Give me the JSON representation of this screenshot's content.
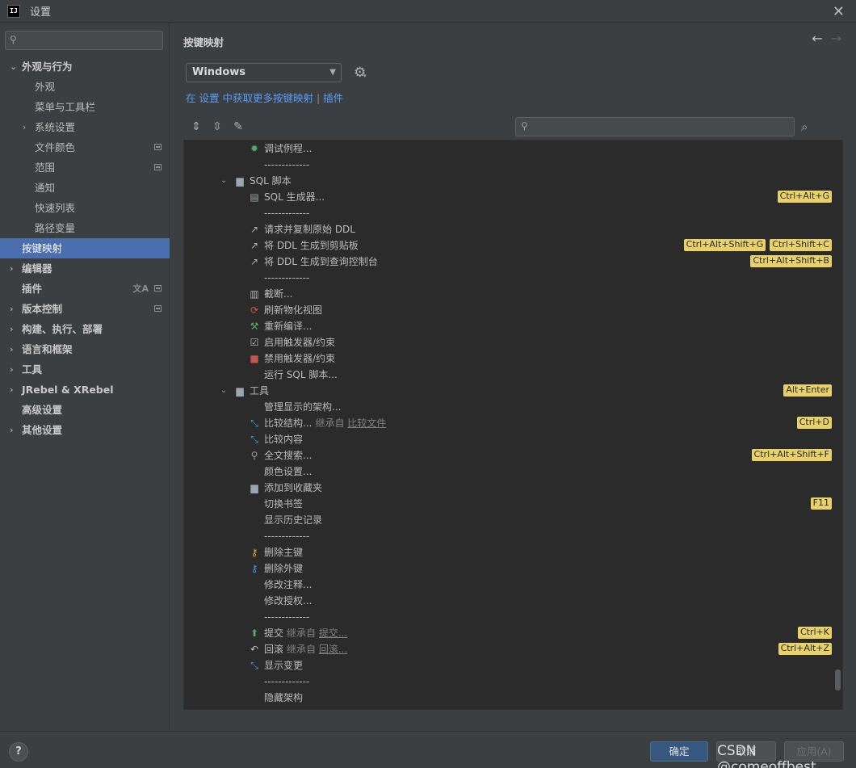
{
  "window": {
    "title": "设置",
    "logo": "IJ"
  },
  "sidebar": {
    "items": [
      {
        "label": "外观与行为",
        "level": 0,
        "expanded": true,
        "bold": true
      },
      {
        "label": "外观",
        "level": 1
      },
      {
        "label": "菜单与工具栏",
        "level": 1
      },
      {
        "label": "系统设置",
        "level": 1,
        "collapsed": true
      },
      {
        "label": "文件颜色",
        "level": 1,
        "badge": true
      },
      {
        "label": "范围",
        "level": 1,
        "badge": true
      },
      {
        "label": "通知",
        "level": 1
      },
      {
        "label": "快速列表",
        "level": 1
      },
      {
        "label": "路径变量",
        "level": 1
      },
      {
        "label": "按键映射",
        "level": 0,
        "selected": true
      },
      {
        "label": "编辑器",
        "level": 0,
        "collapsed": true,
        "bold": true
      },
      {
        "label": "插件",
        "level": 0,
        "bold": true,
        "badge": true,
        "translate": true
      },
      {
        "label": "版本控制",
        "level": 0,
        "collapsed": true,
        "bold": true,
        "badge": true
      },
      {
        "label": "构建、执行、部署",
        "level": 0,
        "collapsed": true,
        "bold": true
      },
      {
        "label": "语言和框架",
        "level": 0,
        "collapsed": true,
        "bold": true
      },
      {
        "label": "工具",
        "level": 0,
        "collapsed": true,
        "bold": true
      },
      {
        "label": "JRebel & XRebel",
        "level": 0,
        "collapsed": true,
        "bold": true
      },
      {
        "label": "高级设置",
        "level": 0,
        "bold": true
      },
      {
        "label": "其他设置",
        "level": 0,
        "collapsed": true,
        "bold": true
      }
    ]
  },
  "panel": {
    "title": "按键映射",
    "keymap": "Windows",
    "link_prefix": "在 设置 中获取更多按键映射",
    "link_sep": "|",
    "link_plugins": "插件"
  },
  "tree": [
    {
      "indent": 3,
      "icon": "bug-icon",
      "label": "调试例程..."
    },
    {
      "indent": 3,
      "label": "-------------"
    },
    {
      "indent": 2,
      "chev": "down",
      "icon": "folder-icon",
      "label": "SQL 脚本"
    },
    {
      "indent": 3,
      "icon": "database-script-icon",
      "label": "SQL 生成器...",
      "keys": [
        "Ctrl+Alt+G"
      ]
    },
    {
      "indent": 3,
      "label": "-------------"
    },
    {
      "indent": 3,
      "icon": "export-arrow-icon",
      "label": "请求并复制原始 DDL"
    },
    {
      "indent": 3,
      "icon": "export-arrow-icon",
      "label": "将 DDL 生成到剪贴板",
      "keys": [
        "Ctrl+Alt+Shift+G",
        "Ctrl+Shift+C"
      ]
    },
    {
      "indent": 3,
      "icon": "export-arrow-icon",
      "label": "将 DDL 生成到查询控制台",
      "keys": [
        "Ctrl+Alt+Shift+B"
      ]
    },
    {
      "indent": 3,
      "label": "-------------"
    },
    {
      "indent": 3,
      "icon": "trash-icon",
      "label": "截断..."
    },
    {
      "indent": 3,
      "icon": "refresh-icon",
      "label": "刷新物化视图"
    },
    {
      "indent": 3,
      "icon": "hammer-icon",
      "label": "重新编译..."
    },
    {
      "indent": 3,
      "icon": "checkbox-icon",
      "label": "启用触发器/约束"
    },
    {
      "indent": 3,
      "icon": "stop-icon",
      "label": "禁用触发器/约束"
    },
    {
      "indent": 3,
      "label": "运行 SQL 脚本..."
    },
    {
      "indent": 2,
      "chev": "down",
      "icon": "folder-icon",
      "label": "工具",
      "keys": [
        "Alt+Enter"
      ]
    },
    {
      "indent": 3,
      "label": "管理显示的架构..."
    },
    {
      "indent": 3,
      "icon": "diff-icon",
      "label": "比较结构...",
      "inherit": "继承自",
      "inherit_link": "比较文件",
      "keys": [
        "Ctrl+D"
      ]
    },
    {
      "indent": 3,
      "icon": "diff-icon",
      "label": "比较内容"
    },
    {
      "indent": 3,
      "icon": "search-icon",
      "label": "全文搜索...",
      "keys": [
        "Ctrl+Alt+Shift+F"
      ]
    },
    {
      "indent": 3,
      "label": "颜色设置..."
    },
    {
      "indent": 3,
      "icon": "folder-icon",
      "label": "添加到收藏夹"
    },
    {
      "indent": 3,
      "label": "切换书签",
      "keys": [
        "F11"
      ]
    },
    {
      "indent": 3,
      "label": "显示历史记录"
    },
    {
      "indent": 3,
      "label": "-------------"
    },
    {
      "indent": 3,
      "icon": "primary-key-icon",
      "label": "删除主键"
    },
    {
      "indent": 3,
      "icon": "foreign-key-icon",
      "label": "删除外键"
    },
    {
      "indent": 3,
      "label": "修改注释..."
    },
    {
      "indent": 3,
      "label": "修改授权..."
    },
    {
      "indent": 3,
      "label": "-------------"
    },
    {
      "indent": 3,
      "icon": "commit-arrow-icon",
      "label": "提交",
      "inherit": "继承自",
      "inherit_link": "提交...",
      "keys": [
        "Ctrl+K"
      ]
    },
    {
      "indent": 3,
      "icon": "rollback-icon",
      "label": "回滚",
      "inherit": "继承自",
      "inherit_link": "回滚...",
      "keys": [
        "Ctrl+Alt+Z"
      ]
    },
    {
      "indent": 3,
      "icon": "diff-icon",
      "label": "显示变更"
    },
    {
      "indent": 3,
      "label": "-------------"
    },
    {
      "indent": 3,
      "label": "隐藏架构"
    }
  ],
  "footer": {
    "help": "?",
    "ok": "确定",
    "cancel": "取消",
    "apply": "应用(A)"
  },
  "watermark": "CSDN @comeoffbest",
  "colors": {
    "accent": "#4b6eaf",
    "shortcut_bg": "#e8d06a",
    "link": "#589df6",
    "tree_bg": "#2b2b2b"
  }
}
